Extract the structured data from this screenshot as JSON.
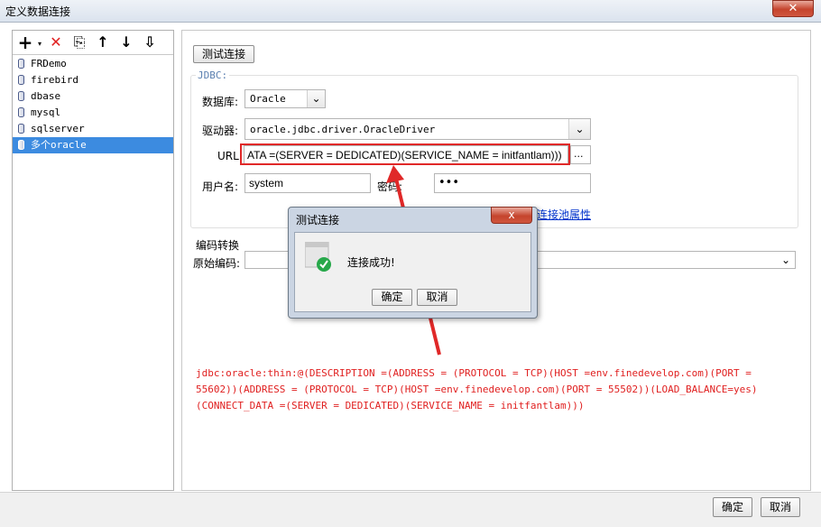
{
  "window": {
    "title": "定义数据连接"
  },
  "toolbar": {
    "add": "+",
    "delete": "✕",
    "copy": "⎘",
    "up": "↑",
    "down": "↓",
    "sort": "⇩"
  },
  "connections": [
    "FRDemo",
    "firebird",
    "dbase",
    "mysql",
    "sqlserver",
    "多个oracle"
  ],
  "selected_connection": "多个oracle",
  "test_button": "测试连接",
  "jdbc": {
    "group_label": "JDBC:",
    "db_label": "数据库:",
    "db_value": "Oracle",
    "driver_label": "驱动器:",
    "driver_value": "oracle.jdbc.driver.OracleDriver",
    "url_label": "URL:",
    "url_value": "ATA =(SERVER = DEDICATED)(SERVICE_NAME = initfantlam)))",
    "url_browse": "...",
    "user_label": "用户名:",
    "user_value": "system",
    "password_label": "密码:",
    "password_value": "•••",
    "pool_link": "连接池属性"
  },
  "encoding": {
    "section_label": "编码转换",
    "raw_label": "原始编码:",
    "raw_value": ""
  },
  "annotation": {
    "line1": "jdbc:oracle:thin:@(DESCRIPTION =(ADDRESS = (PROTOCOL = TCP)(HOST =env.finedevelop.com)(PORT =",
    "line2": "55602))(ADDRESS = (PROTOCOL = TCP)(HOST =env.finedevelop.com)(PORT = 55502))(LOAD_BALANCE=yes)",
    "line3": "(CONNECT_DATA =(SERVER = DEDICATED)(SERVICE_NAME = initfantlam)))"
  },
  "dialog": {
    "title": "测试连接",
    "close": "x",
    "message": "连接成功!",
    "ok": "确定",
    "cancel": "取消"
  },
  "footer": {
    "ok": "确定",
    "cancel": "取消"
  },
  "colors": {
    "selection": "#3c8be0",
    "annotation_red": "#e02828",
    "link": "#0033cc"
  }
}
